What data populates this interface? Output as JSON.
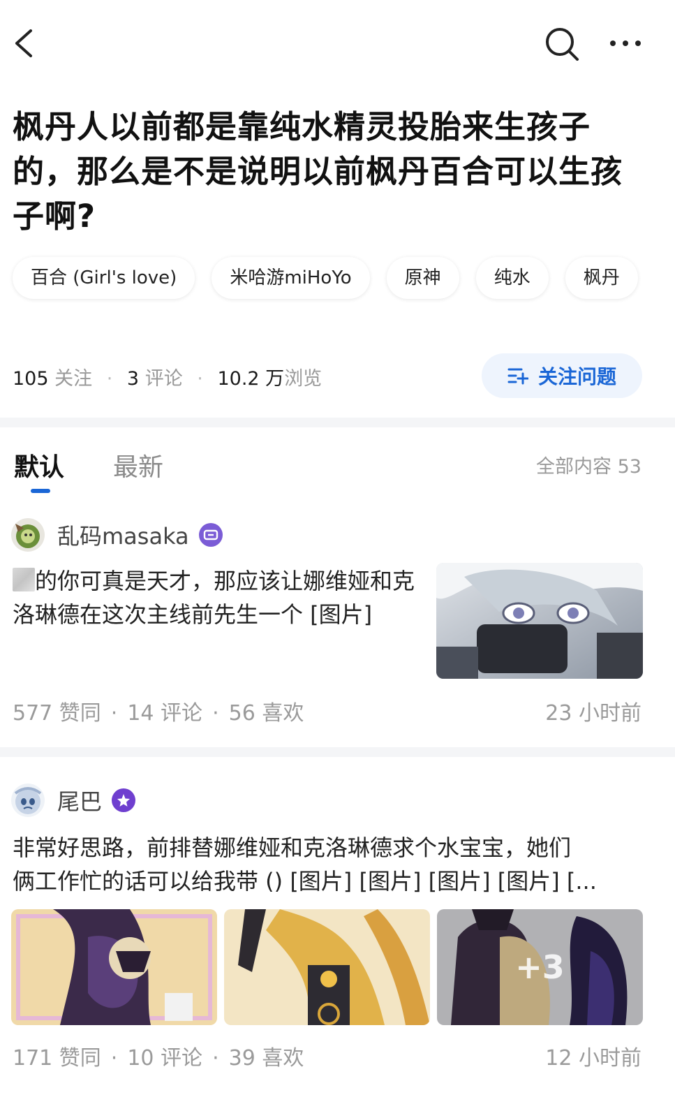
{
  "header": {
    "back_icon": "chevron-left-icon",
    "search_icon": "search-icon",
    "more_icon": "more-dots-icon"
  },
  "question": {
    "title": "枫丹人以前都是靠纯水精灵投胎来生孩子的，那么是不是说明以前枫丹百合可以生孩子啊?",
    "topics": [
      "百合 (Girl's love)",
      "米哈游miHoYo",
      "原神",
      "纯水",
      "枫丹"
    ],
    "stats": {
      "followers": "105",
      "followers_label": "关注",
      "comments": "3",
      "comments_label": "评论",
      "views": "10.2 万",
      "views_label": "浏览"
    },
    "follow_button": "关注问题"
  },
  "tabs": {
    "items": [
      "默认",
      "最新"
    ],
    "active": "默认",
    "all_content": "全部内容 53"
  },
  "answers": [
    {
      "author": "乱码masaka",
      "text": "的你可真是天才，那应该让娜维娅和克洛琳德在这次主线前先生一个 [图片]",
      "likes": "577 赞同",
      "comments": "14 评论",
      "favs": "56 喜欢",
      "time": "23 小时前"
    },
    {
      "author": "尾巴",
      "text_line1": "非常好思路，前排替娜维娅和克洛琳德求个水宝宝，她们",
      "text_line2": "俩工作忙的话可以给我带 () [图片] [图片] [图片] [图片] [...",
      "more_images": "+3",
      "likes": "171 赞同",
      "comments": "10 评论",
      "favs": "39 喜欢",
      "time": "12 小时前"
    }
  ],
  "colors": {
    "accent": "#1a66d6",
    "follow_bg": "#eef4fd",
    "muted": "#9a9a9a",
    "separator": "#f4f5f7"
  }
}
